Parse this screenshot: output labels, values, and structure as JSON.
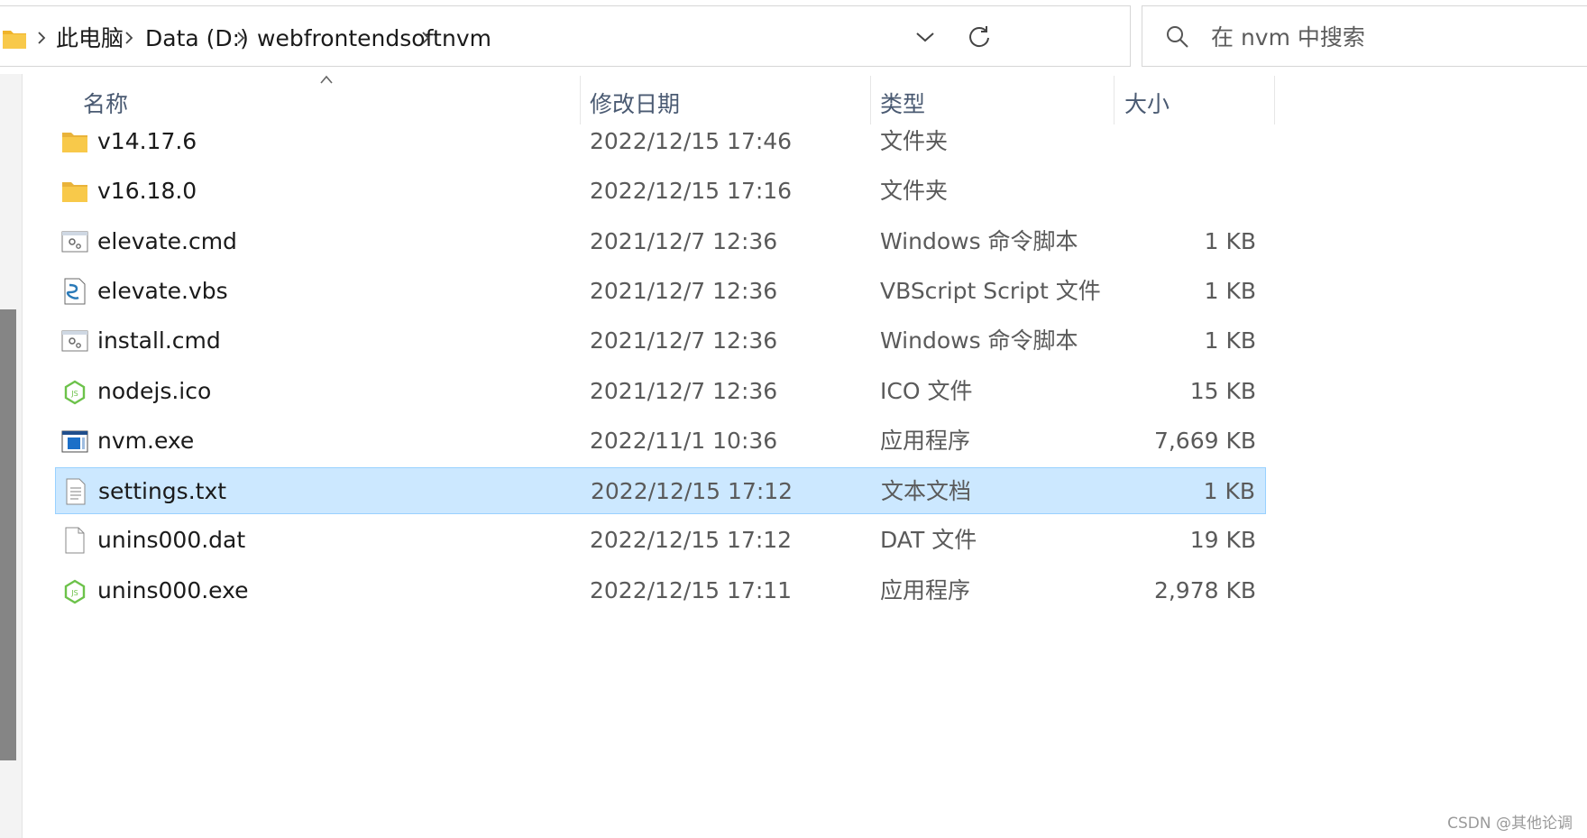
{
  "breadcrumb": [
    "此电脑",
    "Data (D:)",
    "webfrontendsoft",
    "nvm"
  ],
  "search": {
    "placeholder": "在 nvm 中搜索"
  },
  "columns": {
    "name": "名称",
    "date": "修改日期",
    "type": "类型",
    "size": "大小"
  },
  "files": [
    {
      "name": "v14.17.6",
      "date": "2022/12/15 17:46",
      "type": "文件夹",
      "size": "",
      "icon": "folder-icon"
    },
    {
      "name": "v16.18.0",
      "date": "2022/12/15 17:16",
      "type": "文件夹",
      "size": "",
      "icon": "folder-icon"
    },
    {
      "name": "elevate.cmd",
      "date": "2021/12/7 12:36",
      "type": "Windows 命令脚本",
      "size": "1 KB",
      "icon": "cmd-script-icon"
    },
    {
      "name": "elevate.vbs",
      "date": "2021/12/7 12:36",
      "type": "VBScript Script 文件",
      "size": "1 KB",
      "icon": "vbs-script-icon"
    },
    {
      "name": "install.cmd",
      "date": "2021/12/7 12:36",
      "type": "Windows 命令脚本",
      "size": "1 KB",
      "icon": "cmd-script-icon"
    },
    {
      "name": "nodejs.ico",
      "date": "2021/12/7 12:36",
      "type": "ICO 文件",
      "size": "15 KB",
      "icon": "nodejs-icon"
    },
    {
      "name": "nvm.exe",
      "date": "2022/11/1 10:36",
      "type": "应用程序",
      "size": "7,669 KB",
      "icon": "exe-window-icon"
    },
    {
      "name": "settings.txt",
      "date": "2022/12/15 17:12",
      "type": "文本文档",
      "size": "1 KB",
      "icon": "text-document-icon",
      "selected": true
    },
    {
      "name": "unins000.dat",
      "date": "2022/12/15 17:12",
      "type": "DAT 文件",
      "size": "19 KB",
      "icon": "blank-file-icon"
    },
    {
      "name": "unins000.exe",
      "date": "2022/12/15 17:11",
      "type": "应用程序",
      "size": "2,978 KB",
      "icon": "nodejs-icon"
    }
  ],
  "watermark": "CSDN @其他论调",
  "colors": {
    "selected_bg": "#cce8ff",
    "selected_border": "#99d1ff",
    "folder": "#f8c94a",
    "header_text": "#4a5a72",
    "node_green": "#6cc24a"
  }
}
